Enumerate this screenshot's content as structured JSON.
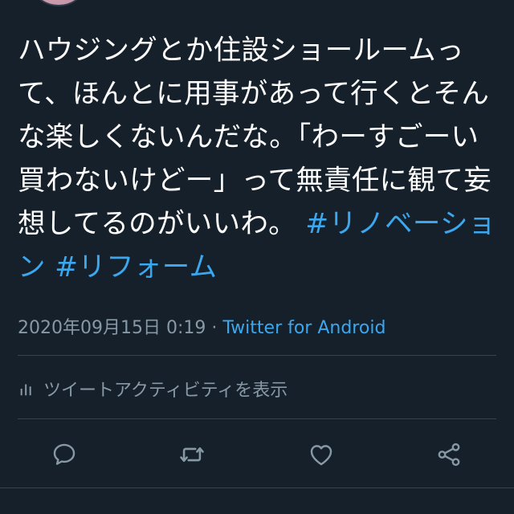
{
  "tweet": {
    "text_segments": [
      "ハウジングとか住設ショールームって、ほんとに用事があって行くとそんな楽しくないんだな。「わーすごーい買わないけどー」って無責任に観て妄想してるのがいいわ。",
      "#リノベーション",
      "#リフォーム"
    ],
    "hashtags": [
      "#リノベーション",
      "#リフォーム"
    ],
    "timestamp": "2020年09月15日 0:19",
    "separator": "·",
    "source": "Twitter for Android"
  },
  "activity": {
    "label": "ツイートアクティビティを表示",
    "icon": "bar-chart-icon"
  },
  "actions": [
    {
      "name": "reply",
      "icon": "reply-icon"
    },
    {
      "name": "retweet",
      "icon": "retweet-icon"
    },
    {
      "name": "like",
      "icon": "heart-icon"
    },
    {
      "name": "share",
      "icon": "share-icon"
    }
  ],
  "colors": {
    "background": "#15202b",
    "text": "#ffffff",
    "secondary": "#8899a6",
    "link": "#3aa7ee",
    "divider": "#38444d"
  }
}
